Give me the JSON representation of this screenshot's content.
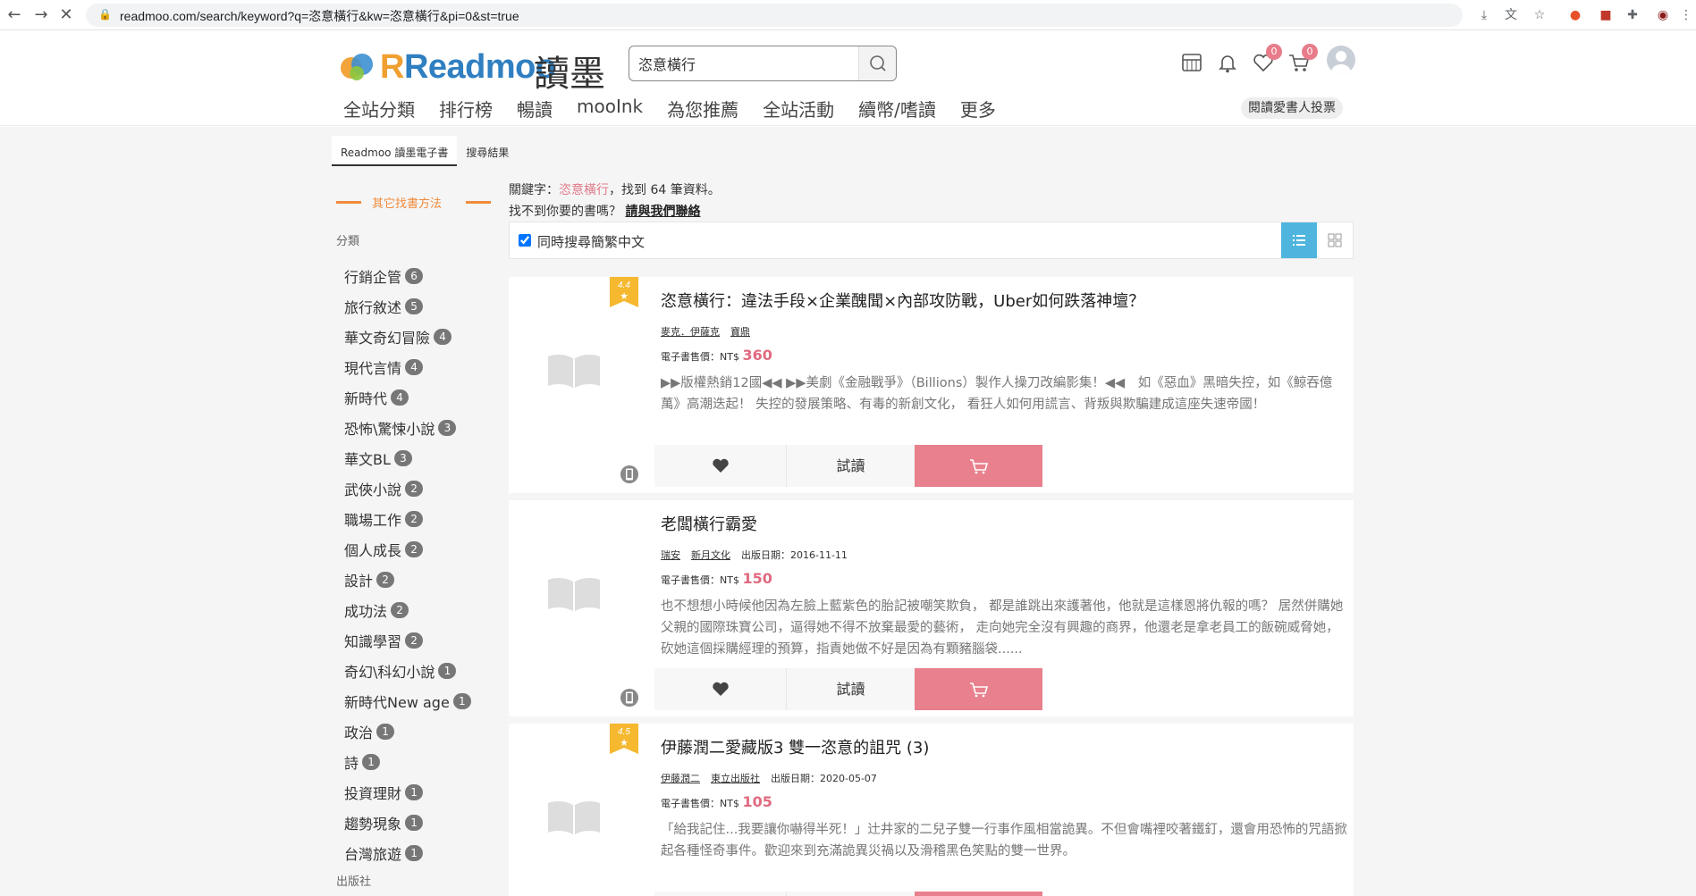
{
  "browser": {
    "url": "readmoo.com/search/keyword?q=恣意橫行&kw=恣意橫行&pi=0&st=true"
  },
  "header": {
    "logo_text": "Readmoo",
    "logo_cn": "讀墨",
    "search_value": "恣意橫行",
    "wishlist_count": "0",
    "cart_count": "0",
    "nav": [
      "全站分類",
      "排行榜",
      "暢讀",
      "mooInk",
      "為您推薦",
      "全站活動",
      "續幣/嗜讀",
      "更多"
    ],
    "vote_label": "閱讀愛書人投票"
  },
  "breadcrumb": [
    "Readmoo 讀墨電子書",
    "搜尋結果"
  ],
  "sidebar": {
    "other_methods": "其它找書方法",
    "category_label": "分類",
    "publisher_label": "出版社",
    "categories": [
      {
        "name": "行銷企管",
        "count": "6"
      },
      {
        "name": "旅行敘述",
        "count": "5"
      },
      {
        "name": "華文奇幻冒險",
        "count": "4"
      },
      {
        "name": "現代言情",
        "count": "4"
      },
      {
        "name": "新時代",
        "count": "4"
      },
      {
        "name": "恐怖\\驚悚小說",
        "count": "3"
      },
      {
        "name": "華文BL",
        "count": "3"
      },
      {
        "name": "武俠小說",
        "count": "2"
      },
      {
        "name": "職場工作",
        "count": "2"
      },
      {
        "name": "個人成長",
        "count": "2"
      },
      {
        "name": "設計",
        "count": "2"
      },
      {
        "name": "成功法",
        "count": "2"
      },
      {
        "name": "知識學習",
        "count": "2"
      },
      {
        "name": "奇幻\\科幻小說",
        "count": "1"
      },
      {
        "name": "新時代New age",
        "count": "1"
      },
      {
        "name": "政治",
        "count": "1"
      },
      {
        "name": "詩",
        "count": "1"
      },
      {
        "name": "投資理財",
        "count": "1"
      },
      {
        "name": "趨勢現象",
        "count": "1"
      },
      {
        "name": "台灣旅遊",
        "count": "1"
      }
    ]
  },
  "results": {
    "kw_prefix": "關鍵字：",
    "keyword": "恣意橫行",
    "kw_suffix": "，找到 64 筆資料。",
    "notfound": "找不到你要的書嗎？",
    "contact": "請與我們聯絡",
    "simul_label": "同時搜尋簡繁中文",
    "trial_label": "試讀",
    "price_label": "電子書售價：NT$ ",
    "books": [
      {
        "rating": "4.4",
        "title": "恣意橫行：違法手段×企業醜聞×內部攻防戰，Uber如何跌落神壇？",
        "author": "麥克．伊薩克",
        "publisher": "寶鼎",
        "date": "",
        "price": "360",
        "desc": "▶▶版權熱銷12國◀◀ ▶▶美劇《金融戰爭》（Billions）製作人操刀改編影集！◀◀　如《惡血》黑暗失控，如《鯨吞億萬》高潮迭起！ 失控的發展策略、有毒的新創文化， 看狂人如何用謊言、背叛與欺騙建成這座失速帝國！"
      },
      {
        "rating": "",
        "title": "老闆橫行霸愛",
        "author": "瑞安",
        "publisher": "新月文化",
        "date": "出版日期：2016-11-11",
        "price": "150",
        "desc": "也不想想小時候他因為左臉上藍紫色的胎記被嘲笑欺負， 都是誰跳出來護著他，他就是這樣恩將仇報的嗎？ 居然併購她父親的國際珠寶公司，逼得她不得不放棄最愛的藝術， 走向她完全沒有興趣的商界，他還老是拿老員工的飯碗威脅她， 砍她這個採購經理的預算，指責她做不好是因為有顆豬腦袋......"
      },
      {
        "rating": "4.5",
        "title": "伊藤潤二愛藏版3 雙一恣意的詛咒 (3)",
        "author": "伊藤潤二",
        "publisher": "東立出版社",
        "date": "出版日期：2020-05-07",
        "price": "105",
        "desc": "「給我記住...我要讓你嚇得半死！」辻井家的二兒子雙一行事作風相當詭異。不但會嘴裡咬著鐵釘，還會用恐怖的咒語掀起各種怪奇事件。歡迎來到充滿詭異災禍以及滑稽黑色笑點的雙一世界。"
      }
    ]
  }
}
